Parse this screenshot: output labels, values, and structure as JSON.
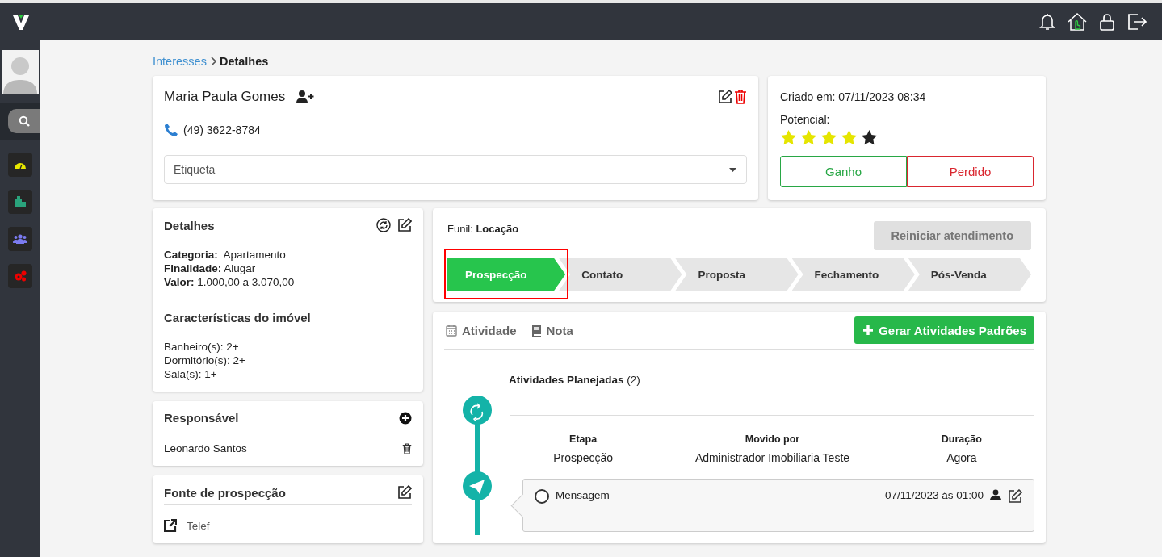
{
  "breadcrumb": [
    {
      "label": "Interesses",
      "kind": "link"
    },
    {
      "label": "Detalhes",
      "kind": "current"
    }
  ],
  "contact": {
    "name": "Maria Paula Gomes",
    "phone": "(49) 3622-8784",
    "tag_select": {
      "placeholder": "Etiqueta"
    }
  },
  "summary": {
    "created": "Criado em: 07/11/2023 08:34",
    "potential_label": "Potencial:",
    "stars": 4,
    "buttons": [
      {
        "label": "Ganho",
        "kind": "won"
      },
      {
        "label": "Perdido",
        "kind": "lost"
      }
    ]
  },
  "details": {
    "title": "Detalhes",
    "fields": [
      "**Categoria:**  Apartamento",
      "**Finalidade:** Alugar",
      "**Valor:** 1.000,00 a 3.070,00"
    ],
    "features_title": "Características do imóvel",
    "features": [
      "Banheiro(s): 2+",
      "Dormitório(s): 2+",
      "Sala(s): 1+"
    ]
  },
  "responsible": {
    "title": "Responsável",
    "name": "Leonardo Santos"
  },
  "source": {
    "title": "Fonte de prospecção",
    "value": "Telef"
  },
  "funnel": {
    "label": "Funil: **Locação**",
    "restart_button": "Reiniciar atendimento",
    "stages": [
      {
        "label": "Prospecção",
        "selected": true
      },
      {
        "label": "Contato",
        "selected": false
      },
      {
        "label": "Proposta",
        "selected": false
      },
      {
        "label": "Fechamento",
        "selected": false
      },
      {
        "label": "Pós-Venda",
        "selected": false
      }
    ]
  },
  "activity": {
    "tabs": [
      {
        "label": "Atividade",
        "kind": "calendar",
        "selected": false
      },
      {
        "label": "Nota",
        "kind": "note",
        "selected": false
      }
    ],
    "generate_button": "Gerar Atividades Padrões",
    "planned_title": "**Atividades Planejadas** (2)",
    "stage_move": [
      {
        "heading": "Etapa",
        "value": "Prospecção"
      },
      {
        "heading": "Movido por",
        "value": "Administrador Imobiliaria Teste"
      },
      {
        "heading": "Duração",
        "value": "Agora"
      }
    ],
    "tasks": [
      {
        "title": "Mensagem",
        "done": false,
        "datetime": "07/11/2023 ás 01:00"
      }
    ]
  }
}
